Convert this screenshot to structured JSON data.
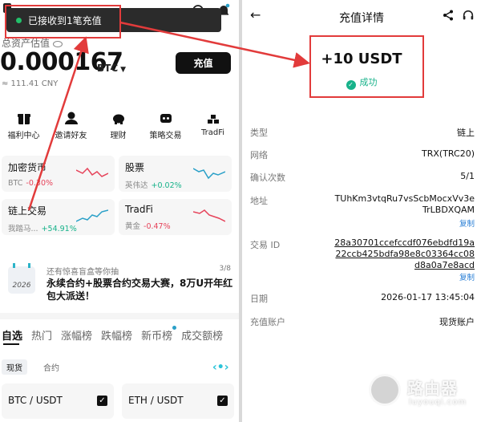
{
  "left": {
    "toast": "已接收到1笔充值",
    "asset_label": "总资产估值",
    "balance": "0.000167",
    "balance_unit": "BTC",
    "fiat": "≈ 111.41 CNY",
    "deposit_label": "充值",
    "shortcuts": [
      {
        "label": "福利中心",
        "icon": "gift-icon"
      },
      {
        "label": "邀请好友",
        "icon": "invite-icon"
      },
      {
        "label": "理财",
        "icon": "piggy-bank-icon"
      },
      {
        "label": "策略交易",
        "icon": "bot-icon"
      },
      {
        "label": "TradFi",
        "icon": "tradfi-icon"
      }
    ],
    "cards": [
      {
        "title": "加密货币",
        "sub": "BTC",
        "change": "-0.30%"
      },
      {
        "title": "股票",
        "sub": "英伟达",
        "change": "+0.02%"
      },
      {
        "title": "链上交易",
        "sub": "我踏马...",
        "change": "+54.91%"
      },
      {
        "title": "TradFi",
        "sub": "黄金",
        "change": "-0.47%"
      }
    ],
    "banner": {
      "small": "还有惊喜盲盒等你抽",
      "page": "3/8",
      "calendar_year": "2026",
      "big": "永续合约+股票合约交易大赛，8万U开年红包大派送！"
    },
    "tabs": [
      "自选",
      "热门",
      "涨幅榜",
      "跌幅榜",
      "新币榜",
      "成交额榜"
    ],
    "subtabs": [
      "现货",
      "合约"
    ],
    "pairs": [
      "BTC / USDT",
      "ETH / USDT"
    ]
  },
  "right": {
    "title": "充值详情",
    "amount": "+10 USDT",
    "status": "成功",
    "rows": {
      "type_label": "类型",
      "type_value": "链上",
      "network_label": "网络",
      "network_value": "TRX(TRC20)",
      "confirm_label": "确认次数",
      "confirm_value": "5/1",
      "address_label": "地址",
      "address_value": "TUhKm3vtqRu7vsScbMocxVv3eTrLBDXQAM",
      "txid_label": "交易 ID",
      "txid_value": "28a30701ccefccdf076ebdfd19a22ccb425bdfa98e8c03364cc08d8a0a7e8acd",
      "copy": "复制",
      "date_label": "日期",
      "date_value": "2026-01-17 13:45:04",
      "account_label": "充值账户",
      "account_value": "现货账户"
    }
  },
  "watermark": {
    "cn": "路由器",
    "en": "luyouqi.com"
  },
  "colors": {
    "annotation": "#e23b3b",
    "success": "#17b28a",
    "down": "#e6435a",
    "accent": "#2aa0c8"
  }
}
